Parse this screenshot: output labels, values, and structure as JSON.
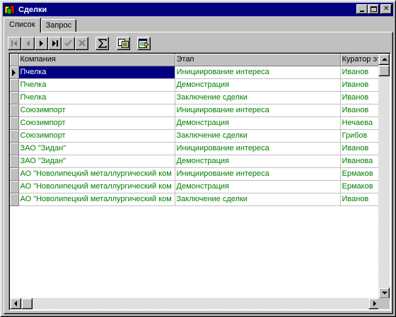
{
  "window": {
    "title": "Сделки",
    "app_icon": "database-app-icon",
    "controls": {
      "minimize": "minimize-icon",
      "maximize": "maximize-icon",
      "close": "close-icon"
    }
  },
  "tabs": [
    {
      "label": "Список",
      "active": true
    },
    {
      "label": "Запрос",
      "active": false
    }
  ],
  "toolbar": {
    "buttons": [
      {
        "name": "first-record-button",
        "icon": "first-record-icon",
        "enabled": false
      },
      {
        "name": "prior-record-button",
        "icon": "prior-record-icon",
        "enabled": false
      },
      {
        "name": "next-record-button",
        "icon": "next-record-icon",
        "enabled": true
      },
      {
        "name": "last-record-button",
        "icon": "last-record-icon",
        "enabled": true
      },
      {
        "name": "post-button",
        "icon": "checkmark-icon",
        "enabled": false
      },
      {
        "name": "cancel-button",
        "icon": "cross-icon",
        "enabled": false
      },
      {
        "name": "sum-button",
        "icon": "sigma-icon",
        "enabled": true
      },
      {
        "name": "copy-button",
        "icon": "copy-records-icon",
        "enabled": true
      },
      {
        "name": "export-button",
        "icon": "export-icon",
        "enabled": true
      }
    ]
  },
  "grid": {
    "columns": [
      "Компания",
      "Этап",
      "Куратор эт"
    ],
    "rows": [
      [
        "Пчелка",
        "Инициирование интереса",
        "Иванов"
      ],
      [
        "Пчелка",
        "Демонстрация",
        "Иванов"
      ],
      [
        "Пчелка",
        "Заключение сделки",
        "Иванов"
      ],
      [
        "Союзимпорт",
        "Инициирование интереса",
        "Иванов"
      ],
      [
        "Союзимпорт",
        "Демонстрация",
        "Нечаева"
      ],
      [
        "Союзимпорт",
        "Заключение сделки",
        "Грибов"
      ],
      [
        "ЗАО \"Зидан\"",
        "Инициирование интереса",
        "Иванов"
      ],
      [
        "ЗАО \"Зидан\"",
        "Демонстрация",
        "Иванова"
      ],
      [
        "АО \"Новолипецкий металлургический ком",
        "Инициирование интереса",
        "Ермаков"
      ],
      [
        "АО \"Новолипецкий металлургический ком",
        "Демонстрация",
        "Ермаков"
      ],
      [
        "АО \"Новолипецкий металлургический ком",
        "Заключение сделки",
        "Иванов"
      ]
    ],
    "selected_row": 0
  },
  "colors": {
    "titlebar": "#000080",
    "data_text": "#008000",
    "selection": "#000080",
    "face": "#c0c0c0"
  }
}
